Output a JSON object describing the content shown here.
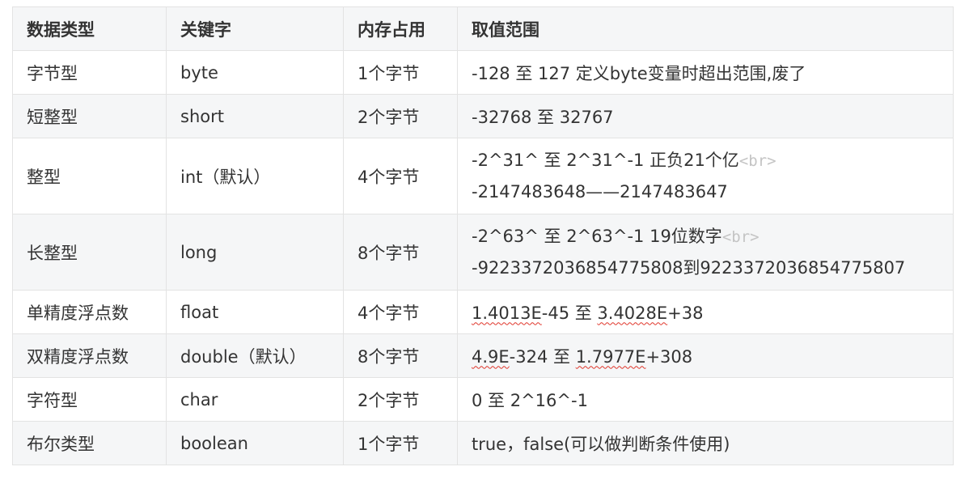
{
  "table": {
    "headers": [
      "数据类型",
      "关键字",
      "内存占用",
      "取值范围"
    ],
    "rows": [
      {
        "type": "字节型",
        "keyword": "byte",
        "memory": "1个字节",
        "range": "-128 至 127  定义byte变量时超出范围,废了"
      },
      {
        "type": "短整型",
        "keyword": "short",
        "memory": "2个字节",
        "range": "-32768 至 32767"
      },
      {
        "type": "整型",
        "keyword": "int（默认）",
        "memory": "4个字节",
        "range_line1": "-2^31^ 至 2^31^-1  正负21个亿",
        "range_tag": "<br>",
        "range_line2": "-2147483648——2147483647"
      },
      {
        "type": "长整型",
        "keyword": "long",
        "memory": "8个字节",
        "range_line1": "-2^63^ 至 2^63^-1   19位数字",
        "range_tag": "<br>",
        "range_line2": "-9223372036854775808到9223372036854775807"
      },
      {
        "type": "单精度浮点数",
        "keyword": "float",
        "memory": "4个字节",
        "range_a": "1.4013E",
        "range_b": "-45 至 ",
        "range_c": "3.4028E",
        "range_d": "+38"
      },
      {
        "type": "双精度浮点数",
        "keyword": "double（默认）",
        "memory": "8个字节",
        "range_a": "4.9E",
        "range_b": "-324 至 ",
        "range_c": "1.7977E",
        "range_d": "+308"
      },
      {
        "type": "字符型",
        "keyword": "char",
        "memory": "2个字节",
        "range": "0 至 2^16^-1"
      },
      {
        "type": "布尔类型",
        "keyword": "boolean",
        "memory": "1个字节",
        "range": "true，false(可以做判断条件使用)"
      }
    ]
  }
}
